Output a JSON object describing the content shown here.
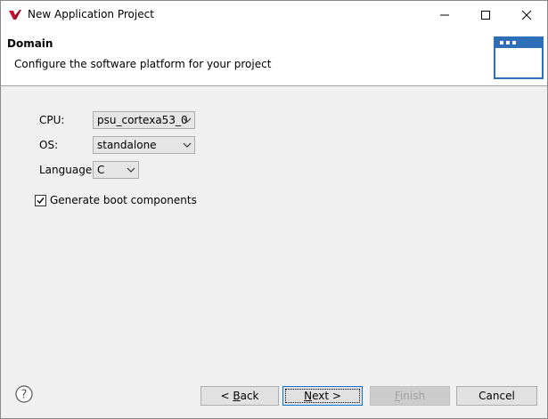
{
  "window": {
    "title": "New Application Project"
  },
  "banner": {
    "title": "Domain",
    "description": "Configure the software platform for your project"
  },
  "form": {
    "cpu": {
      "label": "CPU:",
      "value": "psu_cortexa53_0"
    },
    "os": {
      "label": "OS:",
      "value": "standalone"
    },
    "language": {
      "label": "Language:",
      "value": "C"
    },
    "boot": {
      "label": "Generate boot components",
      "checked": true
    }
  },
  "buttons": {
    "back": {
      "pre": "< ",
      "mnemonic": "B",
      "post": "ack"
    },
    "next": {
      "mnemonic": "N",
      "post": "ext >"
    },
    "finish": {
      "mnemonic": "F",
      "post": "inish"
    },
    "cancel": {
      "label": "Cancel"
    }
  },
  "icons": {
    "app": "xilinx-logo-icon",
    "help": "help-question-icon",
    "banner": "window-wizard-icon"
  },
  "colors": {
    "accent": "#0078d7",
    "logo": "#c8102e"
  }
}
